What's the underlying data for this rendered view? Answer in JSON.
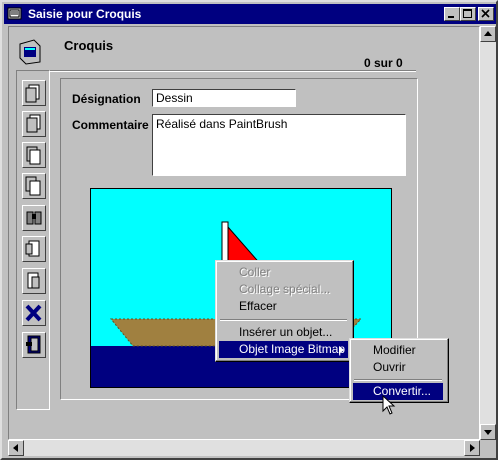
{
  "window": {
    "title": "Saisie pour  Croquis"
  },
  "header": {
    "title": "Croquis",
    "record_counter": "0 sur 0"
  },
  "form": {
    "designation_label": "Désignation",
    "designation_value": "Dessin",
    "comment_label": "Commentaire",
    "comment_value": "Réalisé dans PaintBrush"
  },
  "context_menu": {
    "items": [
      {
        "label": "Coller",
        "enabled": false
      },
      {
        "label": "Collage spécial...",
        "enabled": false
      },
      {
        "label": "Effacer",
        "enabled": true
      },
      {
        "label": "Insérer un objet...",
        "enabled": true
      },
      {
        "label": "Objet Image Bitmap",
        "enabled": true,
        "submenu": true
      }
    ]
  },
  "submenu": {
    "items": [
      {
        "label": "Modifier"
      },
      {
        "label": "Ouvrir"
      },
      {
        "label": "Convertir..."
      }
    ]
  },
  "colors": {
    "titlebar": "#000080",
    "sky": "#00ffff",
    "sea": "#000080",
    "sail": "#ff0000",
    "hull": "#a08040"
  }
}
